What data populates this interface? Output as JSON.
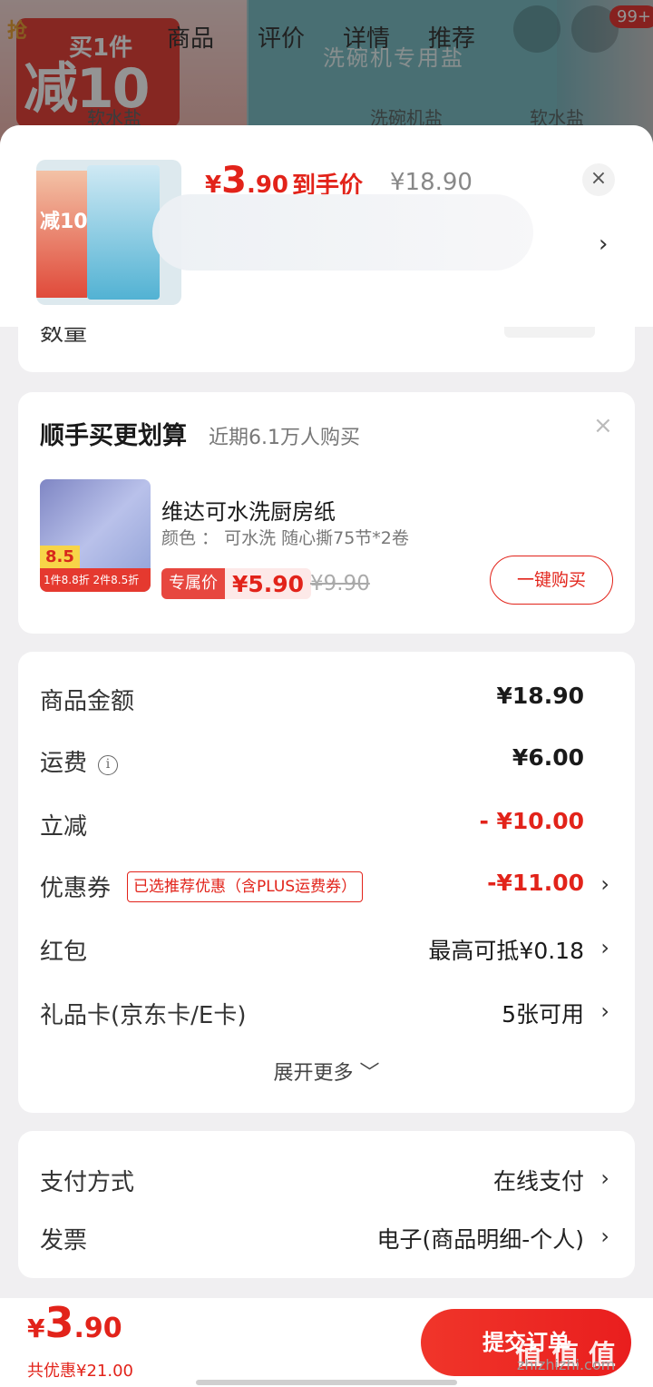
{
  "background_page": {
    "tabs": [
      "商品",
      "评价",
      "详情",
      "推荐"
    ],
    "promo_small": "买1件",
    "promo_big": "减10",
    "rob_label": "抢",
    "banner_text": "洗碗机专用盐",
    "sub_labels": [
      "软水盐",
      "洗碗机盐",
      "软水盐"
    ],
    "badge": "99+"
  },
  "sheet": {
    "thumb_text": "减10",
    "price_symbol": "¥",
    "price_int": "3",
    "price_dec": ".90",
    "price_label": "到手价",
    "original_price": "¥18.90",
    "close": "×",
    "spec_arrow": "›",
    "quantity_label": "数量"
  },
  "addon": {
    "title": "顺手买更划算",
    "subtitle": "近期6.1万人购买",
    "close": "×",
    "img_tag": "1件8.8折 2件8.5折",
    "img_big": "8.5",
    "name": "维达可水洗厨房纸",
    "spec": "颜色 ： 可水洗  随心撕75节*2卷",
    "badge_label": "专属价",
    "badge_price": "¥5.90",
    "old_price": "¥9.90",
    "button": "一键购买"
  },
  "summary": {
    "rows": [
      {
        "label": "商品金额",
        "value": "¥18.90"
      },
      {
        "label": "运费",
        "value": "¥6.00",
        "info": "i"
      },
      {
        "label": "立减",
        "value": "- ¥10.00"
      },
      {
        "label": "优惠券",
        "value": "-¥11.00",
        "tag": "已选推荐优惠（含PLUS运费券）"
      },
      {
        "label": "红包",
        "value": "最高可抵¥0.18"
      },
      {
        "label": "礼品卡(京东卡/E卡)",
        "value": "5张可用"
      }
    ],
    "expand": "展开更多 ﹀",
    "arrow": "›"
  },
  "payment": {
    "rows": [
      {
        "label": "支付方式",
        "value": "在线支付"
      },
      {
        "label": "发票",
        "value": "电子(商品明细-个人)"
      }
    ]
  },
  "bottom": {
    "total_symbol": "¥",
    "total_int": "3",
    "total_dec": ".90",
    "saved": "共优惠¥21.00",
    "submit": "提交订单",
    "watermark": "值 值 值",
    "watermark_site": "zhizhizhi.com"
  },
  "colors": {
    "accent": "#e2231a",
    "page_bg": "#f0eff1"
  }
}
